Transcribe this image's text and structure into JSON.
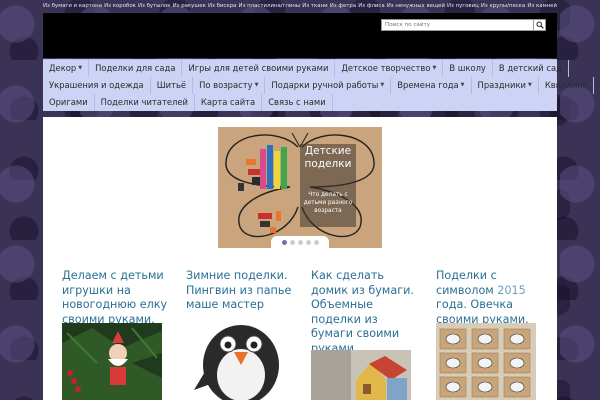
{
  "topbar": {
    "links": [
      "Из бумаги и картона",
      "Из коробок",
      "Из бутылок",
      "Из ракушек",
      "Из бисера",
      "Из пластилина/глины",
      "Из ткани",
      "Из фетра",
      "Из флиса",
      "Из ненужных вещей",
      "Из пуговиц",
      "Из крупы/песка",
      "Из камней"
    ]
  },
  "search": {
    "placeholder": "Поиск по сайту",
    "icon": "search-icon"
  },
  "nav": {
    "row1": [
      {
        "label": "Декор",
        "dropdown": true
      },
      {
        "label": "Поделки для сада",
        "dropdown": false
      },
      {
        "label": "Игры для детей своими руками",
        "dropdown": false
      },
      {
        "label": "Детское творчество",
        "dropdown": true
      },
      {
        "label": "В школу",
        "dropdown": false
      },
      {
        "label": "В детский сад",
        "dropdown": false
      }
    ],
    "row2": [
      {
        "label": "Украшения и одежда",
        "dropdown": false
      },
      {
        "label": "Шитьё",
        "dropdown": false
      },
      {
        "label": "По возрасту",
        "dropdown": true
      },
      {
        "label": "Подарки ручной работы",
        "dropdown": true
      },
      {
        "label": "Времена года",
        "dropdown": true
      },
      {
        "label": "Праздники",
        "dropdown": true
      },
      {
        "label": "Квиллинг",
        "dropdown": false
      }
    ],
    "row3": [
      {
        "label": "Оригами",
        "dropdown": false
      },
      {
        "label": "Поделки читателей",
        "dropdown": false
      },
      {
        "label": "Карта сайта",
        "dropdown": false
      },
      {
        "label": "Связь с нами",
        "dropdown": false
      }
    ],
    "caret": "▼"
  },
  "slider": {
    "title": "Детские поделки",
    "description": "Что делать с детьми разного возраста",
    "dots_total": 5,
    "active_dot": 1
  },
  "posts": [
    {
      "title": "Делаем с детьми игрушки на новогоднюю елку своими руками.",
      "image": "santa-ornament"
    },
    {
      "title": "Зимние поделки. Пингвин из папье маше мастер класс.",
      "image": "paper-mache-penguin"
    },
    {
      "title": "Как сделать домик из бумаги. Объемные поделки из бумаги своими руками.",
      "image": "paper-house"
    },
    {
      "title_before": "Поделки с символом ",
      "title_year": "2015",
      "title_after": " года. Овечка своими руками.",
      "image": "sheep-crafts"
    }
  ],
  "colors": {
    "background": "#3a3356",
    "header": "#000000",
    "nav": "#cdd3f5",
    "post_title": "#2a6f95",
    "accent_dot": "#7a6aaa"
  }
}
